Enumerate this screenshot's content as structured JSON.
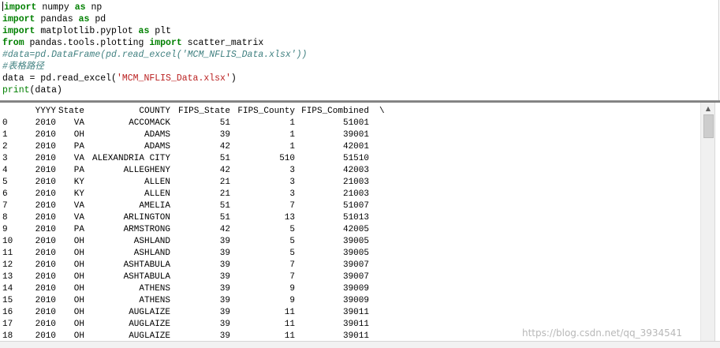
{
  "editor": {
    "lines": [
      {
        "tokens": [
          {
            "t": "import",
            "c": "kw green"
          },
          {
            "t": " numpy ",
            "c": ""
          },
          {
            "t": "as",
            "c": "kw green"
          },
          {
            "t": " np",
            "c": ""
          }
        ]
      },
      {
        "tokens": [
          {
            "t": "import",
            "c": "kw green"
          },
          {
            "t": " pandas ",
            "c": ""
          },
          {
            "t": "as",
            "c": "kw green"
          },
          {
            "t": " pd",
            "c": ""
          }
        ]
      },
      {
        "tokens": [
          {
            "t": "import",
            "c": "kw green"
          },
          {
            "t": " matplotlib.pyplot ",
            "c": ""
          },
          {
            "t": "as",
            "c": "kw green"
          },
          {
            "t": " plt",
            "c": ""
          }
        ]
      },
      {
        "tokens": [
          {
            "t": "from",
            "c": "kw green"
          },
          {
            "t": " pandas.tools.plotting ",
            "c": ""
          },
          {
            "t": "import",
            "c": "kw green"
          },
          {
            "t": " scatter_matrix",
            "c": ""
          }
        ]
      },
      {
        "tokens": [
          {
            "t": "#data=pd.DataFrame(pd.read_excel('MCM_NFLIS_Data.xlsx'))",
            "c": "cm"
          }
        ]
      },
      {
        "tokens": [
          {
            "t": "#表格路径",
            "c": "cm"
          }
        ]
      },
      {
        "tokens": [
          {
            "t": "data = pd.read_excel(",
            "c": ""
          },
          {
            "t": "'MCM_NFLIS_Data.xlsx'",
            "c": "str"
          },
          {
            "t": ")",
            "c": ""
          }
        ]
      },
      {
        "tokens": [
          {
            "t": "print",
            "c": "fn"
          },
          {
            "t": "(data)",
            "c": ""
          }
        ]
      }
    ]
  },
  "output": {
    "headers": {
      "yyyy": "YYYY",
      "state": "State",
      "county": "COUNTY",
      "fips_state": "FIPS_State",
      "fips_county": "FIPS_County",
      "fips_combined": "FIPS_Combined",
      "continuation": "\\"
    },
    "rows": [
      {
        "idx": "0",
        "yyyy": "2010",
        "state": "VA",
        "county": "ACCOMACK",
        "fips_state": "51",
        "fips_county": "1",
        "fips_combined": "51001"
      },
      {
        "idx": "1",
        "yyyy": "2010",
        "state": "OH",
        "county": "ADAMS",
        "fips_state": "39",
        "fips_county": "1",
        "fips_combined": "39001"
      },
      {
        "idx": "2",
        "yyyy": "2010",
        "state": "PA",
        "county": "ADAMS",
        "fips_state": "42",
        "fips_county": "1",
        "fips_combined": "42001"
      },
      {
        "idx": "3",
        "yyyy": "2010",
        "state": "VA",
        "county": "ALEXANDRIA CITY",
        "fips_state": "51",
        "fips_county": "510",
        "fips_combined": "51510"
      },
      {
        "idx": "4",
        "yyyy": "2010",
        "state": "PA",
        "county": "ALLEGHENY",
        "fips_state": "42",
        "fips_county": "3",
        "fips_combined": "42003"
      },
      {
        "idx": "5",
        "yyyy": "2010",
        "state": "KY",
        "county": "ALLEN",
        "fips_state": "21",
        "fips_county": "3",
        "fips_combined": "21003"
      },
      {
        "idx": "6",
        "yyyy": "2010",
        "state": "KY",
        "county": "ALLEN",
        "fips_state": "21",
        "fips_county": "3",
        "fips_combined": "21003"
      },
      {
        "idx": "7",
        "yyyy": "2010",
        "state": "VA",
        "county": "AMELIA",
        "fips_state": "51",
        "fips_county": "7",
        "fips_combined": "51007"
      },
      {
        "idx": "8",
        "yyyy": "2010",
        "state": "VA",
        "county": "ARLINGTON",
        "fips_state": "51",
        "fips_county": "13",
        "fips_combined": "51013"
      },
      {
        "idx": "9",
        "yyyy": "2010",
        "state": "PA",
        "county": "ARMSTRONG",
        "fips_state": "42",
        "fips_county": "5",
        "fips_combined": "42005"
      },
      {
        "idx": "10",
        "yyyy": "2010",
        "state": "OH",
        "county": "ASHLAND",
        "fips_state": "39",
        "fips_county": "5",
        "fips_combined": "39005"
      },
      {
        "idx": "11",
        "yyyy": "2010",
        "state": "OH",
        "county": "ASHLAND",
        "fips_state": "39",
        "fips_county": "5",
        "fips_combined": "39005"
      },
      {
        "idx": "12",
        "yyyy": "2010",
        "state": "OH",
        "county": "ASHTABULA",
        "fips_state": "39",
        "fips_county": "7",
        "fips_combined": "39007"
      },
      {
        "idx": "13",
        "yyyy": "2010",
        "state": "OH",
        "county": "ASHTABULA",
        "fips_state": "39",
        "fips_county": "7",
        "fips_combined": "39007"
      },
      {
        "idx": "14",
        "yyyy": "2010",
        "state": "OH",
        "county": "ATHENS",
        "fips_state": "39",
        "fips_county": "9",
        "fips_combined": "39009"
      },
      {
        "idx": "15",
        "yyyy": "2010",
        "state": "OH",
        "county": "ATHENS",
        "fips_state": "39",
        "fips_county": "9",
        "fips_combined": "39009"
      },
      {
        "idx": "16",
        "yyyy": "2010",
        "state": "OH",
        "county": "AUGLAIZE",
        "fips_state": "39",
        "fips_county": "11",
        "fips_combined": "39011"
      },
      {
        "idx": "17",
        "yyyy": "2010",
        "state": "OH",
        "county": "AUGLAIZE",
        "fips_state": "39",
        "fips_county": "11",
        "fips_combined": "39011"
      },
      {
        "idx": "18",
        "yyyy": "2010",
        "state": "OH",
        "county": "AUGLAIZE",
        "fips_state": "39",
        "fips_county": "11",
        "fips_combined": "39011"
      }
    ]
  },
  "scrollbar": {
    "up_arrow": "▲"
  },
  "watermark": "https://blog.csdn.net/qq_3934541"
}
